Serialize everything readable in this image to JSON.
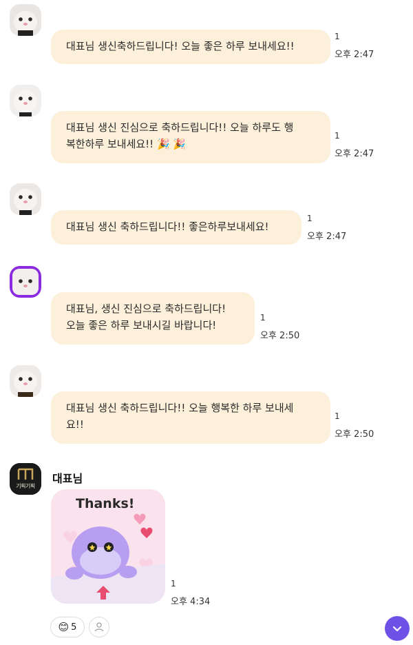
{
  "messages": [
    {
      "text": "대표님 생신축하드립니다! 오늘 좋은 하루 보내세요!!",
      "unread": "1",
      "time": "오후 2:47"
    },
    {
      "text_line1": "대표님 생신 진심으로 축하드립니다!! 오늘 하루도 행",
      "text_line2": "복한하루 보내세요!! 🎉 🎉",
      "unread": "1",
      "time": "오후 2:47"
    },
    {
      "text": "대표님 생신 축하드립니다!! 좋은하루보내세요!",
      "unread": "1",
      "time": "오후 2:47"
    },
    {
      "text_line1": "대표님, 생신 진심으로 축하드립니다!",
      "text_line2": "오늘 좋은 하루 보내시길 바랍니다!",
      "unread": "1",
      "time": "오후 2:50"
    },
    {
      "text_line1": "대표님 생신 축하드립니다!! 오늘 행복한 하루 보내세",
      "text_line2": "요!!",
      "unread": "1",
      "time": "오후 2:50"
    }
  ],
  "boss": {
    "name": "대표님",
    "avatar_text": "기획기획",
    "sticker_text": "Thanks!",
    "unread": "1",
    "time": "오후 4:34"
  },
  "reactions": {
    "emoji": "😊",
    "count": "5"
  },
  "icons": {
    "scroll_down": "chevron-down-icon",
    "profile": "person-icon"
  },
  "colors": {
    "bubble": "#fdf0db",
    "accent": "#6e52e8"
  }
}
